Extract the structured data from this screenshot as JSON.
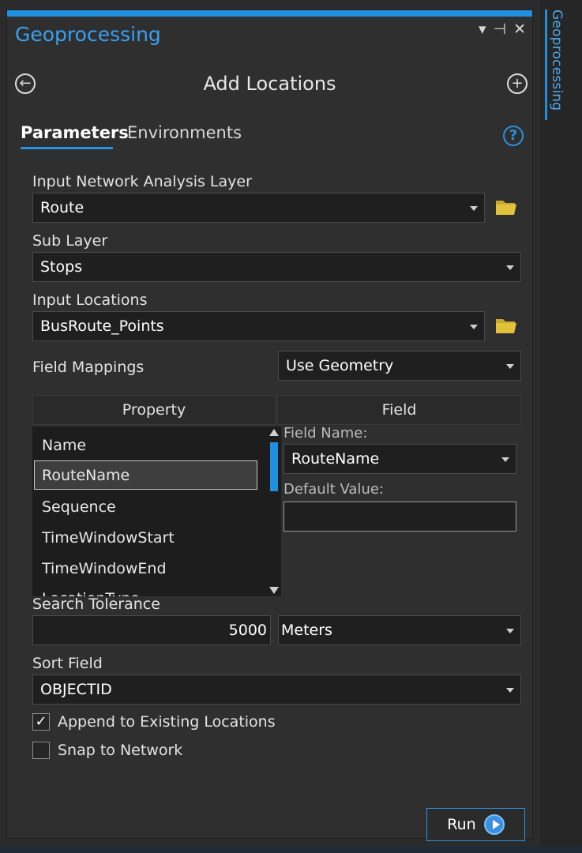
{
  "pane": {
    "title": "Geoprocessing",
    "side_tab": "Geoprocessing",
    "controls": {
      "pin_menu": "▾",
      "pin": "⊣",
      "close": "✕"
    }
  },
  "tool": {
    "title": "Add Locations",
    "tabs": [
      {
        "label": "Parameters",
        "active": true
      },
      {
        "label": "Environments",
        "active": false
      }
    ],
    "help": "?"
  },
  "params": {
    "input_network_layer": {
      "label": "Input Network Analysis Layer",
      "value": "Route"
    },
    "sub_layer": {
      "label": "Sub Layer",
      "value": "Stops"
    },
    "input_locations": {
      "label": "Input Locations",
      "value": "BusRoute_Points"
    },
    "field_mappings": {
      "label": "Field Mappings",
      "value": "Use Geometry",
      "property_header": "Property",
      "field_header": "Field",
      "properties": [
        "Name",
        "RouteName",
        "Sequence",
        "TimeWindowStart",
        "TimeWindowEnd",
        "LocationType"
      ],
      "selected": "RouteName",
      "field_name_label": "Field Name:",
      "field_name_value": "RouteName",
      "default_value_label": "Default Value:",
      "default_value": ""
    },
    "search_tolerance": {
      "label": "Search Tolerance",
      "value": "5000",
      "unit": "Meters"
    },
    "sort_field": {
      "label": "Sort Field",
      "value": "OBJECTID"
    },
    "append": {
      "label": "Append to Existing Locations",
      "checked": true
    },
    "snap": {
      "label": "Snap to Network",
      "checked": false
    }
  },
  "run": {
    "label": "Run"
  },
  "colors": {
    "accent": "#1f8fe0",
    "folder": "#e2c23a",
    "background": "#2f2f2f"
  }
}
